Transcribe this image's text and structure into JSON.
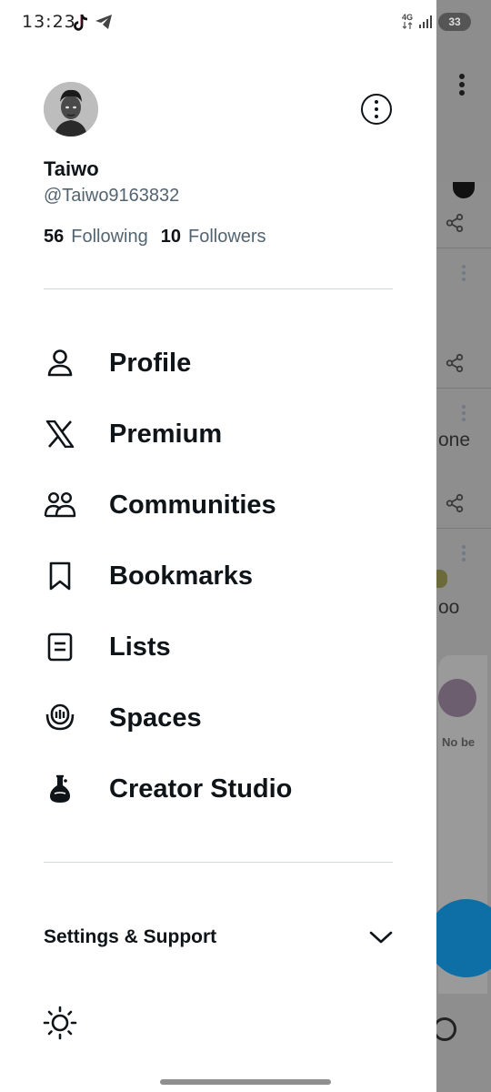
{
  "status_bar": {
    "time": "13:23",
    "network": "4G",
    "battery": "33"
  },
  "profile": {
    "name": "Taiwo",
    "handle": "@Taiwo9163832",
    "following_count": "56",
    "following_label": "Following",
    "followers_count": "10",
    "followers_label": "Followers"
  },
  "menu": {
    "items": [
      {
        "label": "Profile",
        "icon": "person-icon"
      },
      {
        "label": "Premium",
        "icon": "x-logo-icon"
      },
      {
        "label": "Communities",
        "icon": "people-icon"
      },
      {
        "label": "Bookmarks",
        "icon": "bookmark-icon"
      },
      {
        "label": "Lists",
        "icon": "list-icon"
      },
      {
        "label": "Spaces",
        "icon": "microphone-icon"
      },
      {
        "label": "Creator Studio",
        "icon": "flask-icon"
      }
    ]
  },
  "settings": {
    "label": "Settings & Support"
  },
  "background": {
    "fragment_1": "one",
    "fragment_2": "oo",
    "fragment_3": "No be"
  },
  "colors": {
    "primary_text": "#0f1419",
    "secondary_text": "#536471",
    "divider": "#cfd9de"
  }
}
